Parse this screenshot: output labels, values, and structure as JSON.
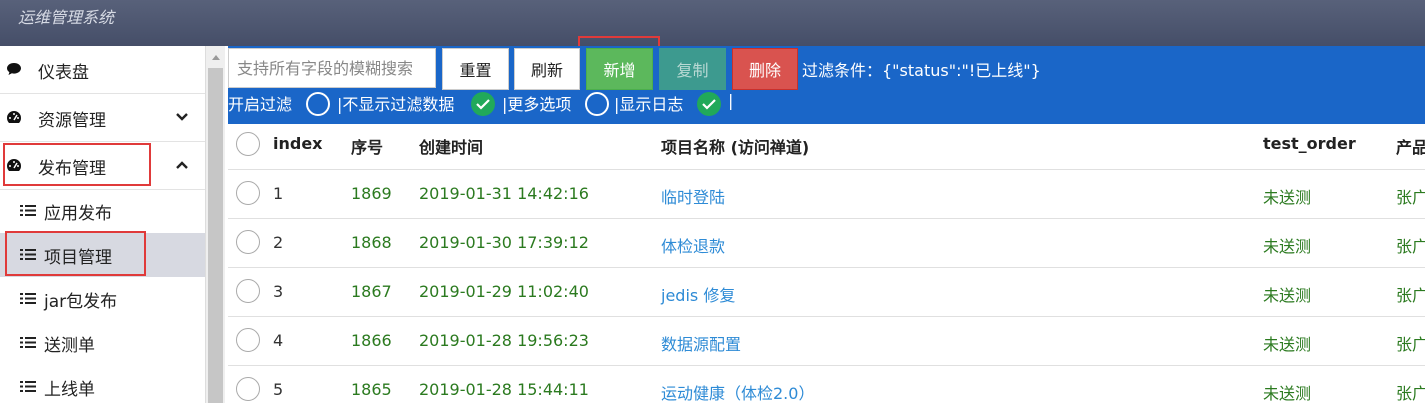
{
  "app": {
    "title": "运维管理系统"
  },
  "sidebar": {
    "items": [
      {
        "label": "仪表盘",
        "icon": "comment-icon"
      },
      {
        "label": "资源管理",
        "icon": "dashboard-icon",
        "chevron": "down"
      },
      {
        "label": "发布管理",
        "icon": "dashboard-icon",
        "chevron": "up"
      }
    ],
    "subitems": [
      {
        "label": "应用发布",
        "icon": "list-icon"
      },
      {
        "label": "项目管理",
        "icon": "list-icon",
        "active": true
      },
      {
        "label": "jar包发布",
        "icon": "list-icon"
      },
      {
        "label": "送测单",
        "icon": "list-icon"
      },
      {
        "label": "上线单",
        "icon": "list-icon"
      }
    ]
  },
  "toolbar": {
    "search_placeholder": "支持所有字段的模糊搜索",
    "reset_label": "重置",
    "refresh_label": "刷新",
    "add_label": "新增",
    "copy_label": "复制",
    "delete_label": "删除",
    "filter_text": "过滤条件：{\"status\":\"!已上线\"}",
    "options": {
      "enable_filter": "开启过滤",
      "hide_filtered": "|不显示过滤数据",
      "more_options": "|更多选项",
      "show_log": "|显示日志",
      "end_sep": "|"
    },
    "option_states": {
      "enable_filter": false,
      "hide_filtered": true,
      "more_options": false,
      "show_log": true
    }
  },
  "table": {
    "headers": {
      "index": "index",
      "seq": "序号",
      "created": "创建时间",
      "name": "项目名称 (访问禅道)",
      "test_order": "test_order",
      "product": "产品"
    },
    "rows": [
      {
        "index": "1",
        "seq": "1869",
        "created": "2019-01-31 14:42:16",
        "name": "临时登陆",
        "test_order": "未送测",
        "product": "张广"
      },
      {
        "index": "2",
        "seq": "1868",
        "created": "2019-01-30 17:39:12",
        "name": "体检退款",
        "test_order": "未送测",
        "product": "张广"
      },
      {
        "index": "3",
        "seq": "1867",
        "created": "2019-01-29 11:02:40",
        "name": "jedis 修复",
        "test_order": "未送测",
        "product": "张广"
      },
      {
        "index": "4",
        "seq": "1866",
        "created": "2019-01-28 19:56:23",
        "name": "数据源配置",
        "test_order": "未送测",
        "product": "张广"
      },
      {
        "index": "5",
        "seq": "1865",
        "created": "2019-01-28 15:44:11",
        "name": "运动健康（体检2.0）",
        "test_order": "未送测",
        "product": "张广"
      }
    ]
  },
  "colors": {
    "toolbar_blue": "#1a66c8",
    "toggle_on": "#21a95a",
    "highlight_red": "#e03a3a"
  }
}
